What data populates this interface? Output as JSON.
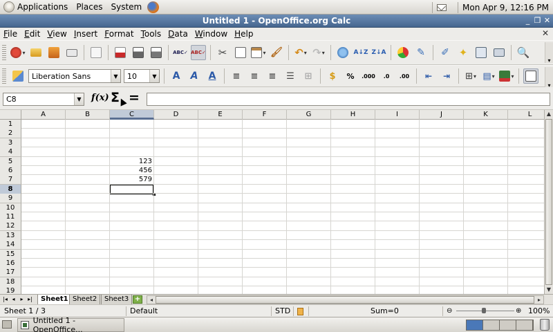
{
  "panel": {
    "menus": [
      "Applications",
      "Places",
      "System"
    ],
    "clock": "Mon Apr  9, 12:16 PM"
  },
  "window": {
    "title": "Untitled 1 - OpenOffice.org Calc",
    "title_bg": "#4f6f98"
  },
  "menubar": [
    "File",
    "Edit",
    "View",
    "Insert",
    "Format",
    "Tools",
    "Data",
    "Window",
    "Help"
  ],
  "format_toolbar": {
    "font_name": "Liberation Sans",
    "font_size": "10"
  },
  "formula": {
    "name_box": "C8",
    "content": ""
  },
  "grid": {
    "columns": [
      "A",
      "B",
      "C",
      "D",
      "E",
      "F",
      "G",
      "H",
      "I",
      "J",
      "K",
      "L"
    ],
    "rows": [
      "1",
      "2",
      "3",
      "4",
      "5",
      "6",
      "7",
      "8",
      "9",
      "10",
      "11",
      "12",
      "13",
      "14",
      "15",
      "16",
      "17",
      "18",
      "19"
    ],
    "selected_column": "C",
    "selected_row": "8",
    "cells": [
      {
        "ref": "C5",
        "value": "123"
      },
      {
        "ref": "C6",
        "value": "456"
      },
      {
        "ref": "C7",
        "value": "579"
      }
    ]
  },
  "sheet_tabs": [
    "Sheet1",
    "Sheet2",
    "Sheet3"
  ],
  "active_sheet": "Sheet1",
  "status": {
    "sheet": "Sheet 1 / 3",
    "style": "Default",
    "mode": "STD",
    "sum": "Sum=0",
    "zoom": "100%"
  },
  "taskbar": {
    "task": "Untitled 1 - OpenOffice..."
  }
}
